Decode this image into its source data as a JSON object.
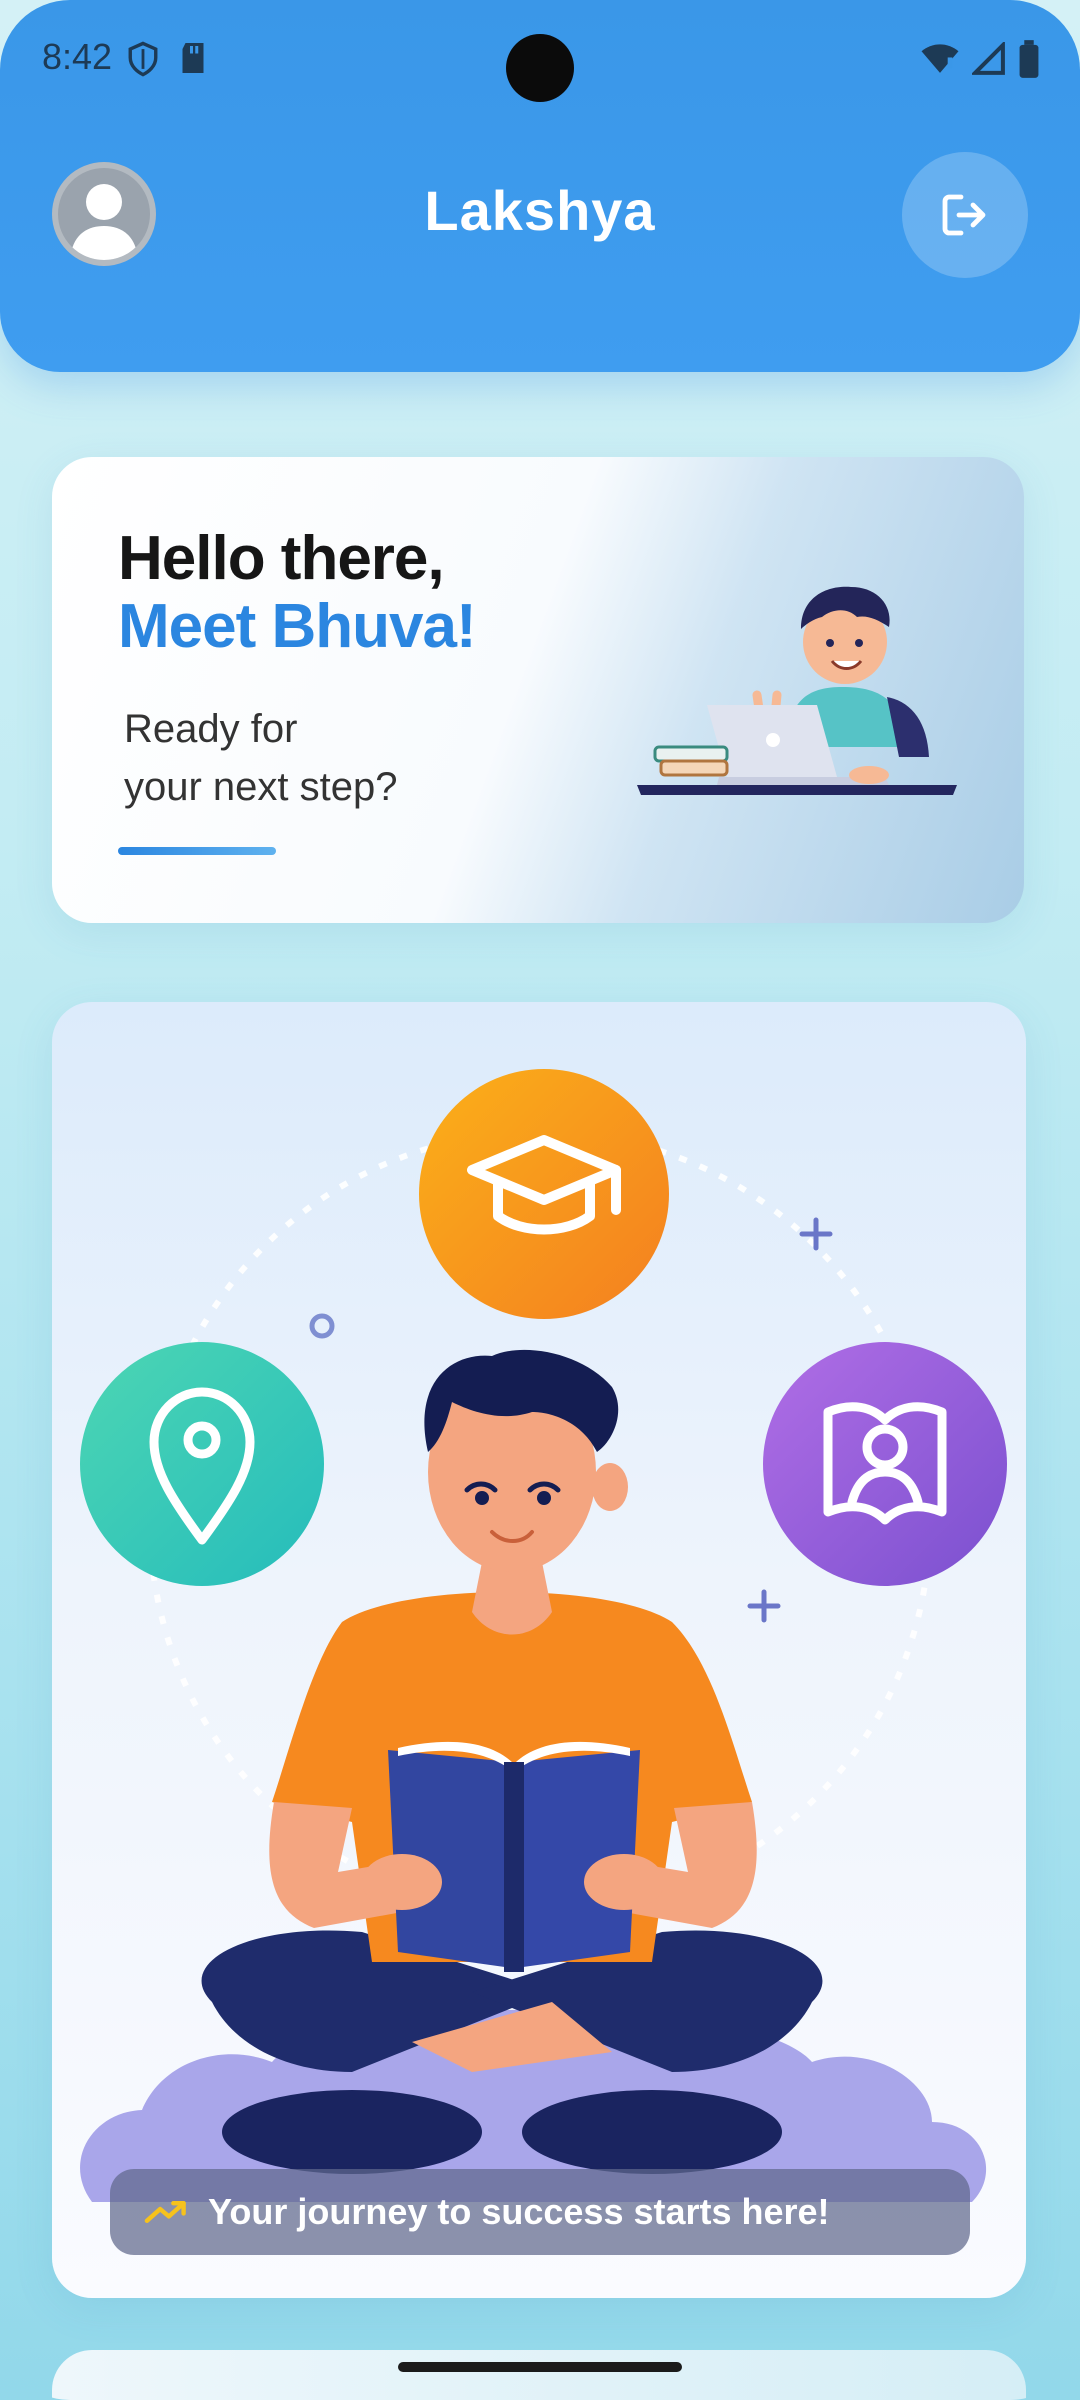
{
  "status_bar": {
    "time": "8:42",
    "left_icons": [
      "shield-icon",
      "sd-card-icon"
    ],
    "right_icons": [
      "wifi-icon",
      "signal-icon",
      "battery-icon"
    ]
  },
  "header": {
    "title": "Lakshya",
    "avatar_icon": "user-avatar-icon",
    "logout_icon": "logout-icon"
  },
  "greeting": {
    "line1": "Hello there,",
    "line2": "Meet Bhuva!",
    "sub_line1": "Ready for",
    "sub_line2": "your next step?"
  },
  "hero": {
    "feature_icons": [
      "graduation-cap-icon",
      "location-pin-icon",
      "profile-book-icon"
    ],
    "banner_icon": "trending-up-icon",
    "banner_text": "Your journey to success starts here!"
  },
  "colors": {
    "header_blue": "#3a97e8",
    "accent_blue": "#2b86e0",
    "orange": "#f6921e",
    "teal": "#2ec6b6",
    "purple": "#8b5ad6"
  }
}
